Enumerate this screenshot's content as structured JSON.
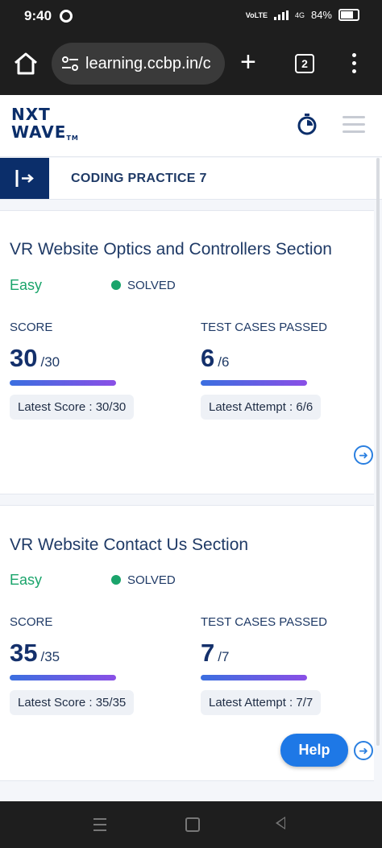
{
  "status": {
    "time": "9:40",
    "network": "VoLTE",
    "signal": "4G",
    "battery": "84%"
  },
  "browser": {
    "url": "learning.ccbp.in/c",
    "tab_count": "2",
    "new_tab": "+"
  },
  "app": {
    "logo_line1": "NXT",
    "logo_line2": "WAVE",
    "logo_tm": "TM"
  },
  "practice": {
    "title": "CODING PRACTICE 7"
  },
  "cards": [
    {
      "title": "VR Website Optics and Controllers Section",
      "difficulty": "Easy",
      "status": "SOLVED",
      "score_label": "SCORE",
      "score": "30",
      "score_total": "/30",
      "tests_label": "TEST CASES PASSED",
      "tests": "6",
      "tests_total": "/6",
      "latest_score": "Latest Score : 30/30",
      "latest_attempt": "Latest Attempt : 6/6"
    },
    {
      "title": "VR Website Contact Us Section",
      "difficulty": "Easy",
      "status": "SOLVED",
      "score_label": "SCORE",
      "score": "35",
      "score_total": "/35",
      "tests_label": "TEST CASES PASSED",
      "tests": "7",
      "tests_total": "/7",
      "latest_score": "Latest Score : 35/35",
      "latest_attempt": "Latest Attempt : 7/7"
    }
  ],
  "help": {
    "label": "Help"
  },
  "colors": {
    "brand": "#0b2e6a",
    "accent": "#1e78e6",
    "success": "#1aa46b"
  },
  "icons": [
    "home-icon",
    "tune-icon",
    "timer-icon",
    "hamburger-icon",
    "sidebar-toggle-icon",
    "arrow-right-circle-icon"
  ]
}
